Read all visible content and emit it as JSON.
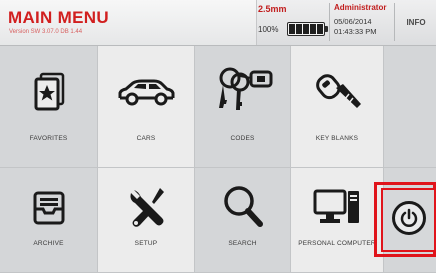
{
  "header": {
    "title": "MAIN MENU",
    "version": "Version SW 3.07.0 DB 1.44",
    "depth": "2.5mm",
    "battery_percent": "100%",
    "battery_level": 1.0,
    "user": "Administrator",
    "date": "05/06/2014",
    "time": "01:43:33 PM",
    "info_label": "INFO"
  },
  "menu": {
    "favorites": "FAVORITES",
    "cars": "CARS",
    "codes": "CODES",
    "key_blanks": "KEY BLANKS",
    "archive": "ARCHIVE",
    "setup": "SETUP",
    "search": "SEARCH",
    "personal_computer": "PERSONAL COMPUTER"
  },
  "icons": {
    "favorites": "star-card-icon",
    "cars": "car-icon",
    "codes": "keys-icon",
    "key_blanks": "key-blank-icon",
    "archive": "archive-tray-icon",
    "setup": "tools-icon",
    "search": "magnifier-icon",
    "personal_computer": "computer-icon",
    "power": "power-icon"
  },
  "colors": {
    "title": "#d11f1f",
    "highlight": "#e0141b",
    "tile_light": "#ececec",
    "tile_dark": "#d4d6d8"
  }
}
